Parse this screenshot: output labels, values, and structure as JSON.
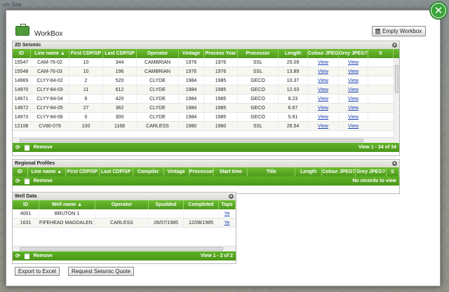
{
  "map": {
    "label": "-on-Sea"
  },
  "dialog": {
    "title": "WorkBox",
    "empty_button": "Empty Workbox",
    "close_icon": "close-x-icon"
  },
  "seismic2d": {
    "title": "2D Seismic",
    "columns": [
      "ID",
      "Line name ▲",
      "First CDP/SP",
      "Last CDP/SP",
      "Operator",
      "Vintage",
      "Process Year",
      "Processor",
      "Length",
      "Colour JPEG?",
      "Grey JPEG?",
      "S"
    ],
    "rows": [
      [
        "15547",
        "CAM-76-02",
        "10",
        "344",
        "CAMBRIAN",
        "1976",
        "1976",
        "SSL",
        "25.09",
        "View",
        "View"
      ],
      [
        "15548",
        "CAM-76-03",
        "10",
        "196",
        "CAMBRIAN",
        "1976",
        "1976",
        "SSL",
        "13.89",
        "View",
        "View"
      ],
      [
        "14969",
        "CLYY-84-02",
        "2",
        "520",
        "CLYDE",
        "1984",
        "1985",
        "GECO",
        "10.37",
        "View",
        "View"
      ],
      [
        "14970",
        "CLYY-84-03",
        "11",
        "612",
        "CLYDE",
        "1984",
        "1985",
        "GECO",
        "12.03",
        "View",
        "View"
      ],
      [
        "14971",
        "CLYY-84-04",
        "6",
        "420",
        "CLYDE",
        "1984",
        "1985",
        "GECO",
        "8.23",
        "View",
        "View"
      ],
      [
        "14972",
        "CLYY-84-05",
        "27",
        "362",
        "CLYDE",
        "1984",
        "1985",
        "GECO",
        "6.67",
        "View",
        "View"
      ],
      [
        "14973",
        "CLYY-84-06",
        "0",
        "300",
        "CLYDE",
        "1984",
        "1985",
        "GECO",
        "5.91",
        "View",
        "View"
      ],
      [
        "12108",
        "CV80-079",
        "100",
        "1168",
        "CARLESS",
        "1980",
        "1980",
        "SSL",
        "26.54",
        "View",
        "View"
      ]
    ],
    "remove_label": "Remove",
    "pager": "View 1 - 34 of 34"
  },
  "regional": {
    "title": "Regional Profiles",
    "columns": [
      "ID",
      "Line name ▲",
      "First CDP/SP",
      "Last CDP/SP",
      "Compiler",
      "Vintage",
      "Processor",
      "Start time",
      "Title",
      "Length",
      "Colour JPEG?",
      "Grey JPEG?",
      "S"
    ],
    "remove_label": "Remove",
    "pager": "No records to view"
  },
  "well": {
    "title": "Well Data",
    "columns": [
      "ID",
      "Well name ▲",
      "Operator",
      "Spudded",
      "Completed",
      "Tops"
    ],
    "rows": [
      [
        "4001",
        "BRUTON 1",
        "",
        "",
        "",
        "Ye"
      ],
      [
        "1631",
        "FIFEHEAD MAGDALEN 1",
        "CARLESS",
        "26/07/1985",
        "12/08/1985",
        "Ye"
      ]
    ],
    "remove_label": "Remove",
    "pager": "View 1 - 2 of 2"
  },
  "actions": {
    "export": "Export to Excel",
    "quote": "Request Seismic Quote"
  },
  "colors": {
    "accent": "#4f9a1e",
    "link": "#1a3fb5"
  }
}
